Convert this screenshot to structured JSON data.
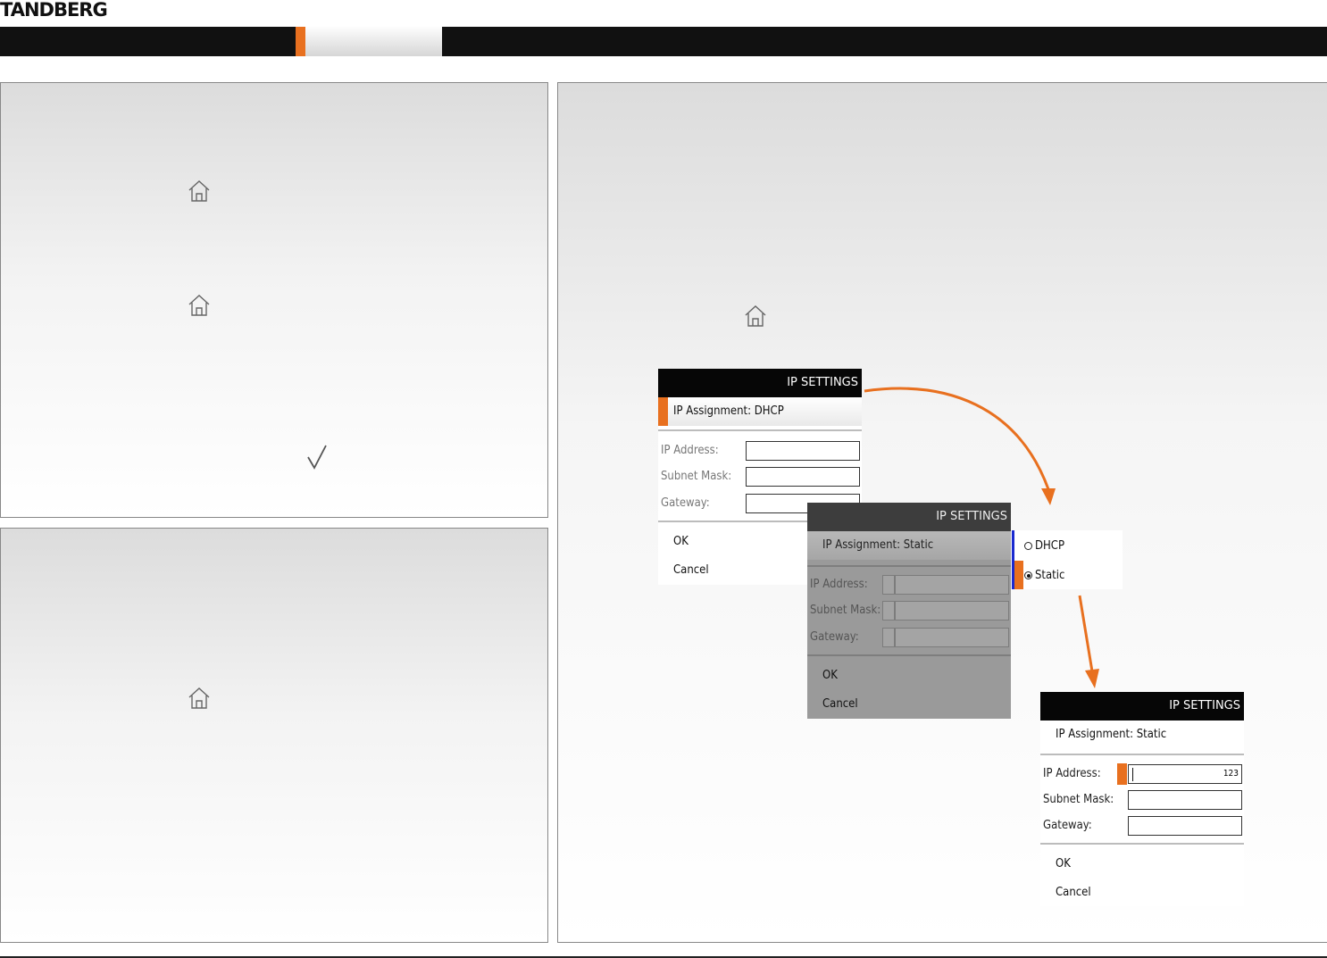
{
  "brand": {
    "logo_text": "TANDBERG",
    "accent_color": "#e8701f"
  },
  "icons": {
    "home": "home-icon",
    "check": "checkmark-icon",
    "arrow": "curved-arrow-icon"
  },
  "dialog_dhcp": {
    "title": "IP SETTINGS",
    "assignment": "IP Assignment: DHCP",
    "fields": [
      "IP Address:",
      "Subnet Mask:",
      "Gateway:"
    ],
    "ok": "OK",
    "cancel": "Cancel"
  },
  "dialog_static_dim": {
    "title": "IP SETTINGS",
    "assignment": "IP Assignment: Static",
    "fields": [
      "IP Address:",
      "Subnet Mask:",
      "Gateway:"
    ],
    "ok": "OK",
    "cancel": "Cancel"
  },
  "dropdown": {
    "options": [
      "DHCP",
      "Static"
    ],
    "selected": "Static"
  },
  "dialog_static": {
    "title": "IP SETTINGS",
    "assignment": "IP Assignment: Static",
    "fields": [
      "IP Address:",
      "Subnet Mask:",
      "Gateway:"
    ],
    "ip_value": "123",
    "ok": "OK",
    "cancel": "Cancel"
  }
}
